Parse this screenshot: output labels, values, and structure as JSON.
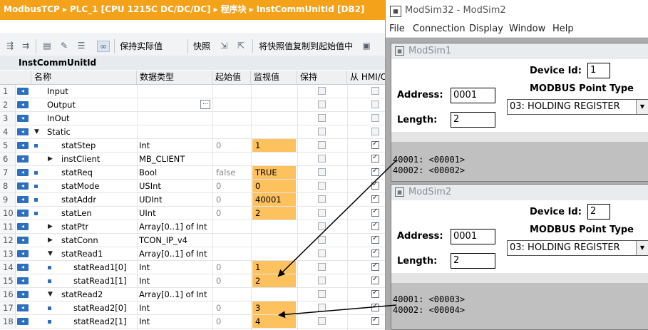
{
  "breadcrumb": [
    "ModbusTCP",
    "PLC_1 [CPU 1215C DC/DC/DC]",
    "程序块",
    "InstCommUnitId [DB2]"
  ],
  "breadcrumb_sep": "▸",
  "toolbar": {
    "keep_actual": "保持实际值",
    "snapshot": "快照",
    "copy_snapshot": "将快照值复制到起始值中"
  },
  "db_title": "InstCommUnitId",
  "columns": {
    "name": "名称",
    "datatype": "数据类型",
    "start": "起始值",
    "monitor": "监视值",
    "retain": "保持",
    "hmi": "从 HMI/OPC..."
  },
  "rows": [
    {
      "n": "1",
      "name": "Input",
      "type": "",
      "start": "",
      "mon": "",
      "retain": false,
      "hmi": false,
      "indent": 1,
      "exp": "",
      "hl": false
    },
    {
      "n": "2",
      "name": "Output",
      "type": "",
      "start": "",
      "mon": "",
      "retain": false,
      "hmi": false,
      "indent": 1,
      "exp": "",
      "hl": false
    },
    {
      "n": "3",
      "name": "InOut",
      "type": "",
      "start": "",
      "mon": "",
      "retain": false,
      "hmi": false,
      "indent": 1,
      "exp": "",
      "hl": false
    },
    {
      "n": "4",
      "name": "Static",
      "type": "",
      "start": "",
      "mon": "",
      "retain": false,
      "hmi": false,
      "indent": 1,
      "exp": "▼",
      "hl": false
    },
    {
      "n": "5",
      "name": "statStep",
      "type": "Int",
      "start": "0",
      "mon": "1",
      "retain": false,
      "hmi": true,
      "indent": 2,
      "exp": "",
      "hl": true
    },
    {
      "n": "6",
      "name": "instClient",
      "type": "MB_CLIENT",
      "start": "",
      "mon": "",
      "retain": false,
      "hmi": true,
      "indent": 2,
      "exp": "▶",
      "hl": false
    },
    {
      "n": "7",
      "name": "statReq",
      "type": "Bool",
      "start": "false",
      "mon": "TRUE",
      "retain": false,
      "hmi": true,
      "indent": 2,
      "exp": "",
      "hl": true
    },
    {
      "n": "8",
      "name": "statMode",
      "type": "USInt",
      "start": "0",
      "mon": "0",
      "retain": false,
      "hmi": true,
      "indent": 2,
      "exp": "",
      "hl": true
    },
    {
      "n": "9",
      "name": "statAddr",
      "type": "UDInt",
      "start": "0",
      "mon": "40001",
      "retain": false,
      "hmi": true,
      "indent": 2,
      "exp": "",
      "hl": true
    },
    {
      "n": "10",
      "name": "statLen",
      "type": "UInt",
      "start": "0",
      "mon": "2",
      "retain": false,
      "hmi": true,
      "indent": 2,
      "exp": "",
      "hl": true
    },
    {
      "n": "11",
      "name": "statPtr",
      "type": "Array[0..1] of Int",
      "start": "",
      "mon": "",
      "retain": false,
      "hmi": true,
      "indent": 2,
      "exp": "▶",
      "hl": false
    },
    {
      "n": "12",
      "name": "statConn",
      "type": "TCON_IP_v4",
      "start": "",
      "mon": "",
      "retain": false,
      "hmi": true,
      "indent": 2,
      "exp": "▶",
      "hl": false
    },
    {
      "n": "13",
      "name": "statRead1",
      "type": "Array[0..1] of Int",
      "start": "",
      "mon": "",
      "retain": false,
      "hmi": true,
      "indent": 2,
      "exp": "▼",
      "hl": false
    },
    {
      "n": "14",
      "name": "statRead1[0]",
      "type": "Int",
      "start": "0",
      "mon": "1",
      "retain": false,
      "hmi": true,
      "indent": 3,
      "exp": "",
      "hl": true
    },
    {
      "n": "15",
      "name": "statRead1[1]",
      "type": "Int",
      "start": "0",
      "mon": "2",
      "retain": false,
      "hmi": true,
      "indent": 3,
      "exp": "",
      "hl": true
    },
    {
      "n": "16",
      "name": "statRead2",
      "type": "Array[0..1] of Int",
      "start": "",
      "mon": "",
      "retain": false,
      "hmi": true,
      "indent": 2,
      "exp": "▼",
      "hl": false
    },
    {
      "n": "17",
      "name": "statRead2[0]",
      "type": "Int",
      "start": "0",
      "mon": "3",
      "retain": false,
      "hmi": true,
      "indent": 3,
      "exp": "",
      "hl": true
    },
    {
      "n": "18",
      "name": "statRead2[1]",
      "type": "Int",
      "start": "0",
      "mon": "4",
      "retain": false,
      "hmi": true,
      "indent": 3,
      "exp": "",
      "hl": true
    }
  ],
  "modsim": {
    "title": "ModSim32 - ModSim2",
    "app_icon": "ModSim icon",
    "menu": [
      "File",
      "Connection",
      "Display",
      "Window",
      "Help"
    ],
    "windows": [
      {
        "title": "ModSim1",
        "device_id_label": "Device Id:",
        "device_id": "1",
        "point_type_label": "MODBUS Point Type",
        "address_label": "Address:",
        "address": "0001",
        "length_label": "Length:",
        "length": "2",
        "point_type": "03: HOLDING REGISTER",
        "values": [
          "40001: <00001>",
          "40002: <00002>"
        ]
      },
      {
        "title": "ModSim2",
        "device_id_label": "Device Id:",
        "device_id": "2",
        "point_type_label": "MODBUS Point Type",
        "address_label": "Address:",
        "address": "0001",
        "length_label": "Length:",
        "length": "2",
        "point_type": "03: HOLDING REGISTER",
        "values": [
          "40001: <00003>",
          "40002: <00004>"
        ]
      }
    ]
  }
}
